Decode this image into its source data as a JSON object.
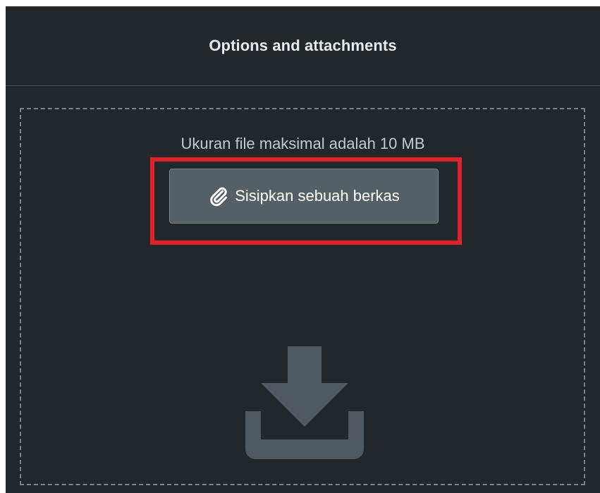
{
  "panel": {
    "title": "Options and attachments"
  },
  "dropzone": {
    "size_note": "Ukuran file maksimal adalah 10 MB",
    "attach_button": {
      "label": "Sisipkan sebuah berkas",
      "icon": "paperclip-icon"
    },
    "drop_icon": "download-icon"
  },
  "colors": {
    "background": "#22272b",
    "button": "#556066",
    "highlight": "#e3212b",
    "drop_icon": "#4e585e"
  }
}
